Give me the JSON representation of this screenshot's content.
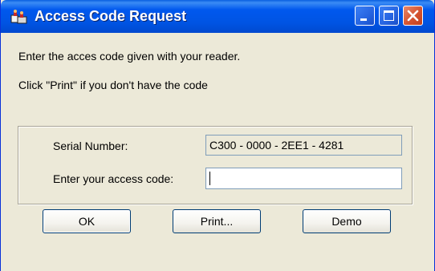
{
  "window": {
    "title": "Access Code Request",
    "controls": {
      "minimize": "minimize",
      "maximize": "maximize",
      "close": "close"
    }
  },
  "messages": {
    "line1": "Enter the acces code given with your reader.",
    "line2": "Click \"Print\" if you don't have the code"
  },
  "form": {
    "serial_label": "Serial Number:",
    "serial_value": "C300 - 0000 - 2EE1 - 4281",
    "code_label": "Enter your access code:",
    "code_value": ""
  },
  "buttons": {
    "ok": "OK",
    "print": "Print...",
    "demo": "Demo"
  },
  "colors": {
    "titlebar": "#0054e3",
    "dialog_bg": "#ece9d8",
    "close_button": "#d5532f"
  },
  "icons": [
    "app-reader-icon",
    "minimize-icon",
    "maximize-icon",
    "close-icon"
  ]
}
